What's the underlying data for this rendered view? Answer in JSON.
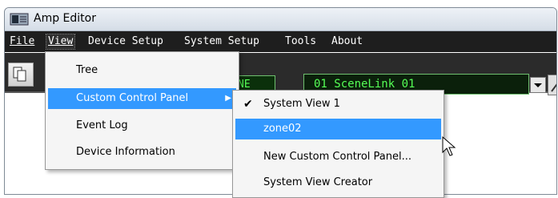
{
  "window": {
    "title": "Amp Editor"
  },
  "menubar": {
    "items": [
      {
        "label": "File"
      },
      {
        "label": "View"
      },
      {
        "label": "Device Setup"
      },
      {
        "label": "System Setup"
      },
      {
        "label": "Tools"
      },
      {
        "label": "About"
      }
    ]
  },
  "toolbar": {
    "scene_box_text": "NE",
    "scene_display": "01  SceneLink 01"
  },
  "view_menu": {
    "items": [
      {
        "label": "Tree"
      },
      {
        "label": "Custom Control Panel"
      },
      {
        "label": "Event Log"
      },
      {
        "label": "Device Information"
      }
    ]
  },
  "submenu": {
    "items": [
      {
        "label": "System View 1",
        "checked": true
      },
      {
        "label": "zone02"
      },
      {
        "label": "New Custom Control Panel..."
      },
      {
        "label": "System View Creator"
      }
    ]
  },
  "colors": {
    "highlight": "#3399ff",
    "menubar_bg": "#1e1e1e",
    "lcd_green": "#56ff56"
  },
  "icons": {
    "app": "amp-editor-icon",
    "check": "check-icon",
    "submenu_arrow": "chevron-right-icon",
    "cursor": "mouse-pointer-icon"
  }
}
